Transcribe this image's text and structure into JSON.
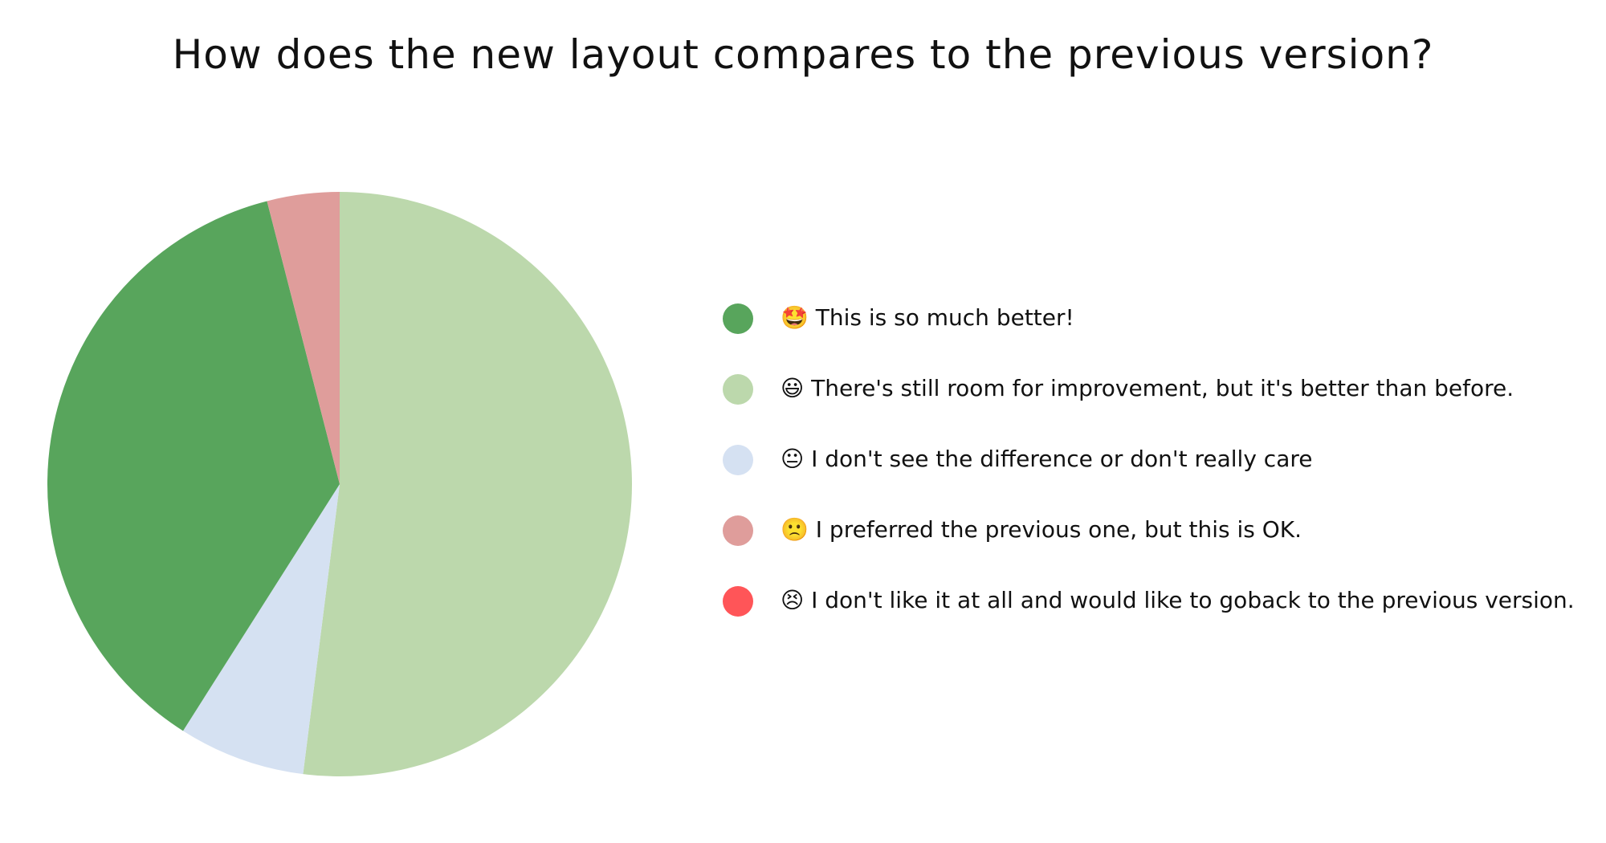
{
  "chart_data": {
    "type": "pie",
    "title": "How does the new layout compares to the previous version?",
    "legend_position": "right",
    "slices": [
      {
        "label": "🤩 This is so much better!",
        "value": 37,
        "color": "#58a55c"
      },
      {
        "label": "😃 There's still room for improvement, but it's better than before.",
        "value": 52,
        "color": "#bcd8ac"
      },
      {
        "label": "😐 I don't see the difference or don't really care",
        "value": 7,
        "color": "#d5e1f2"
      },
      {
        "label": "🙁 I preferred the previous one, but this is OK.",
        "value": 4,
        "color": "#df9d9b"
      },
      {
        "label": "😣 I don't like it at all and would like to goback to the previous version.",
        "value": 0,
        "color": "#ff5558"
      }
    ],
    "draw_order": [
      1,
      2,
      0,
      3
    ]
  }
}
